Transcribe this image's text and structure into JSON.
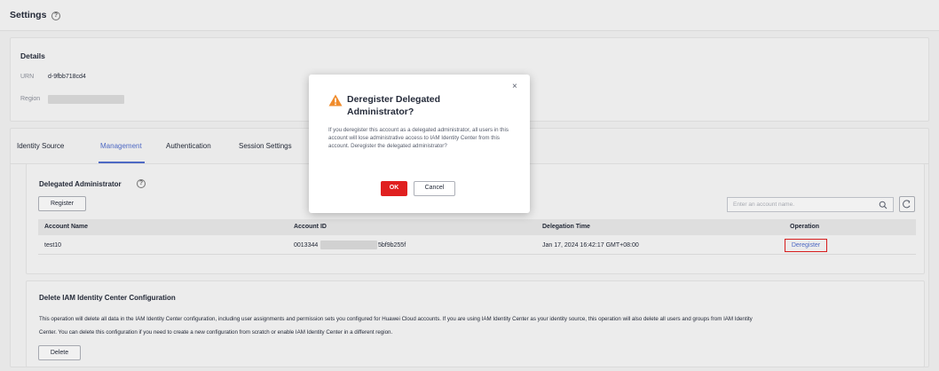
{
  "header": {
    "title": "Settings"
  },
  "details": {
    "heading": "Details",
    "urn_label": "URN",
    "urn_value": "d-9fbb718cd4",
    "region_label": "Region"
  },
  "tabs": [
    {
      "label": "Identity Source"
    },
    {
      "label": "Management"
    },
    {
      "label": "Authentication"
    },
    {
      "label": "Session Settings"
    }
  ],
  "delegated": {
    "heading": "Delegated Administrator",
    "register_label": "Register",
    "search_placeholder": "Enter an account name.",
    "columns": [
      "Account Name",
      "Account ID",
      "Delegation Time",
      "Operation"
    ],
    "rows": [
      {
        "account_name": "test10",
        "account_id_prefix": "0013344",
        "account_id_suffix": "5bf9b255f",
        "delegation_time": "Jan 17, 2024 16:42:17 GMT+08:00",
        "operation": "Deregister"
      }
    ]
  },
  "delete_config": {
    "heading": "Delete IAM Identity Center Configuration",
    "line1": "This operation will delete all data in the IAM Identity Center configuration, including user assignments and permission sets you configured for Huawei Cloud accounts. If you are using IAM Identity Center as your identity source, this operation will also delete all users and groups from IAM Identity",
    "line2": "Center. You can delete this configuration if you need to create a new configuration from scratch or enable IAM Identity Center in a different region.",
    "delete_label": "Delete"
  },
  "modal": {
    "title": "Deregister Delegated Administrator?",
    "body": "If you deregister this account as a delegated administrator, all users in this account will lose administrative access to IAM Identity Center from this account. Deregister the delegated administrator?",
    "ok_label": "OK",
    "cancel_label": "Cancel",
    "close_glyph": "×"
  },
  "colors": {
    "accent": "#526ecc",
    "danger": "#e02020",
    "warning": "#f08c2c"
  },
  "icons": [
    "help-icon",
    "search-icon",
    "refresh-icon",
    "warning-icon",
    "close-icon"
  ]
}
